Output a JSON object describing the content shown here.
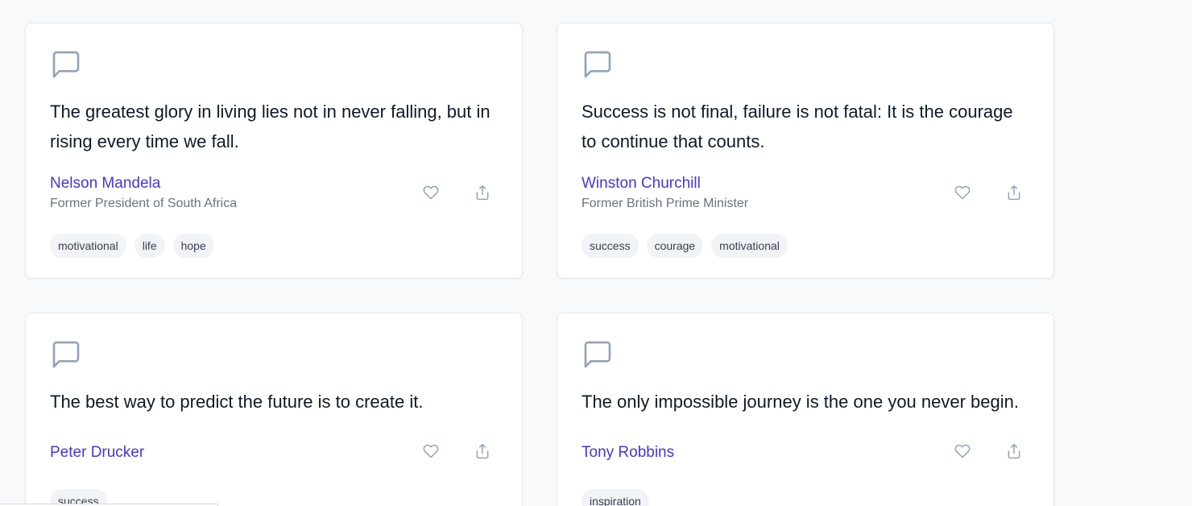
{
  "colors": {
    "author": "#4338ca",
    "icon": "#94a3b8",
    "tag_bg": "#f1f3f6"
  },
  "cards": [
    {
      "quote": "The greatest glory in living lies not in never falling, but in rising every time we fall.",
      "author": "Nelson Mandela",
      "author_title": "Former President of South Africa",
      "tags": [
        "motivational",
        "life",
        "hope"
      ],
      "icons": {
        "quote": "message-square-icon",
        "like": "heart-icon",
        "share": "share-icon"
      }
    },
    {
      "quote": "Success is not final, failure is not fatal: It is the courage to continue that counts.",
      "author": "Winston Churchill",
      "author_title": "Former British Prime Minister",
      "tags": [
        "success",
        "courage",
        "motivational"
      ],
      "icons": {
        "quote": "message-square-icon",
        "like": "heart-icon",
        "share": "share-icon"
      }
    },
    {
      "quote": "The best way to predict the future is to create it.",
      "author": "Peter Drucker",
      "author_title": "",
      "tags": [
        "success"
      ],
      "icons": {
        "quote": "message-square-icon",
        "like": "heart-icon",
        "share": "share-icon"
      }
    },
    {
      "quote": "The only impossible journey is the one you never begin.",
      "author": "Tony Robbins",
      "author_title": "",
      "tags": [
        "inspiration"
      ],
      "icons": {
        "quote": "message-square-icon",
        "like": "heart-icon",
        "share": "share-icon"
      }
    }
  ]
}
